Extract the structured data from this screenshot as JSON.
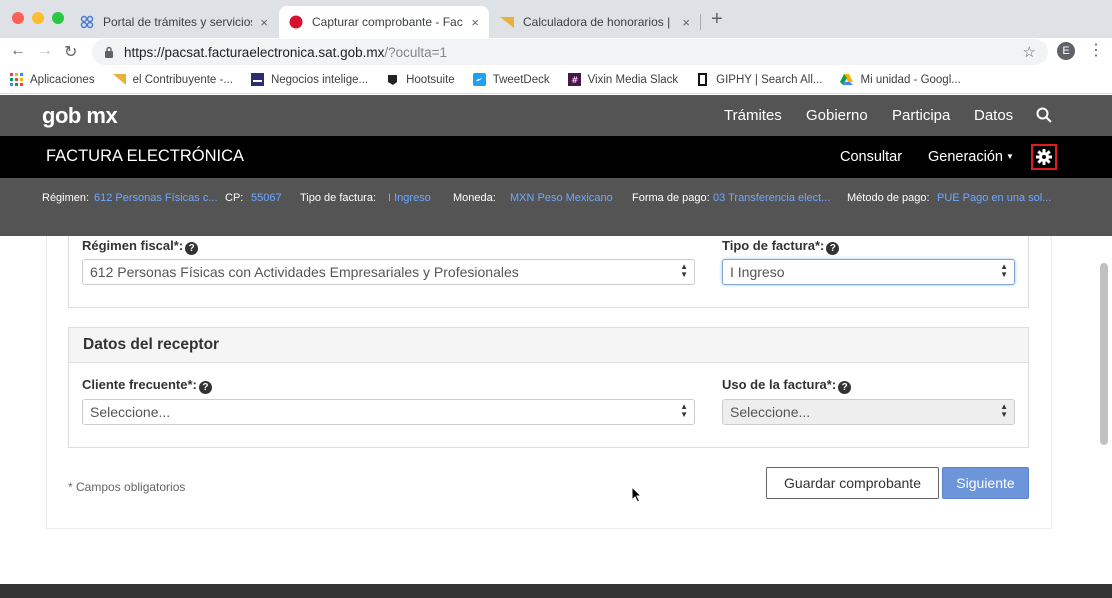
{
  "browser": {
    "tabs": [
      {
        "title": "Portal de trámites y servicios -",
        "close": "×"
      },
      {
        "title": "Capturar comprobante - Factu",
        "close": "×"
      },
      {
        "title": "Calculadora de honorarios | el",
        "close": "×"
      }
    ],
    "new_tab": "+",
    "url_host": "https://pacsat.facturaelectronica.sat.gob.mx",
    "url_path": "/?oculta=1",
    "profile_initial": "E",
    "bookmarks": [
      {
        "label": "Aplicaciones",
        "icon": "apps-grid-icon"
      },
      {
        "label": "el Contribuyente -...",
        "icon": "contribuyente-icon"
      },
      {
        "label": "Negocios intelige...",
        "icon": "negocios-icon"
      },
      {
        "label": "Hootsuite",
        "icon": "hootsuite-icon"
      },
      {
        "label": "TweetDeck",
        "icon": "tweetdeck-icon"
      },
      {
        "label": "Vixin Media Slack",
        "icon": "slack-icon"
      },
      {
        "label": "GIPHY | Search All...",
        "icon": "giphy-icon"
      },
      {
        "label": "Mi unidad - Googl...",
        "icon": "google-drive-icon"
      }
    ]
  },
  "gob": {
    "logo": "gob mx",
    "nav": [
      "Trámites",
      "Gobierno",
      "Participa",
      "Datos"
    ]
  },
  "factura": {
    "title": "FACTURA ELECTRÓNICA",
    "consultar": "Consultar",
    "generacion": "Generación"
  },
  "info": {
    "regimen_label": "Régimen:",
    "regimen_value": "612 Personas Físicas c...",
    "cp_label": "CP:",
    "cp_value": "55067",
    "tipo_label": "Tipo de factura:",
    "tipo_value": "I Ingreso",
    "moneda_label": "Moneda:",
    "moneda_value": "MXN Peso Mexicano",
    "forma_label": "Forma de pago:",
    "forma_value": "03 Transferencia elect...",
    "metodo_label": "Método de pago:",
    "metodo_value": "PUE Pago en una sol..."
  },
  "form": {
    "regimen_fiscal_label": "Régimen fiscal*:",
    "regimen_fiscal_value": "612 Personas Físicas con Actividades Empresariales y Profesionales",
    "tipo_factura_label": "Tipo de factura*:",
    "tipo_factura_value": "I Ingreso",
    "receptor_title": "Datos del receptor",
    "cliente_label": "Cliente frecuente*:",
    "cliente_value": "Seleccione...",
    "uso_label": "Uso de la factura*:",
    "uso_value": "Seleccione...",
    "required_note": "* Campos obligatorios",
    "save_button": "Guardar comprobante",
    "next_button": "Siguiente"
  }
}
